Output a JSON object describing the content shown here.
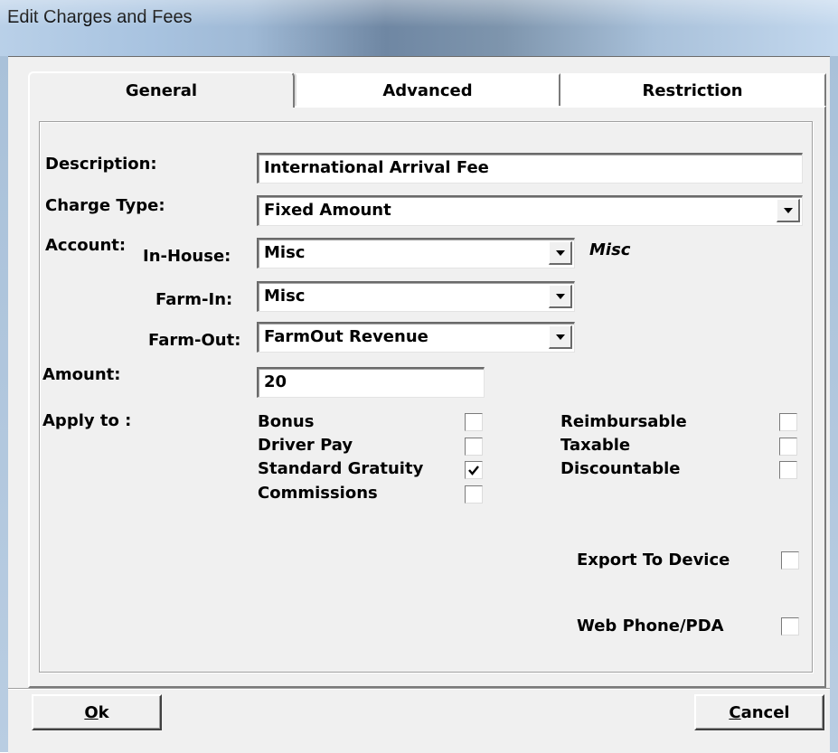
{
  "window": {
    "title": "Edit  Charges and Fees"
  },
  "tabs": [
    {
      "label": "General",
      "selected": true
    },
    {
      "label": "Advanced",
      "selected": false
    },
    {
      "label": "Restriction",
      "selected": false
    }
  ],
  "form": {
    "description": {
      "label": "Description:",
      "value": "International Arrival Fee"
    },
    "charge_type": {
      "label": "Charge Type:",
      "value": "Fixed Amount"
    },
    "account": {
      "label": "Account:",
      "in_house": {
        "label": "In-House:",
        "value": "Misc"
      },
      "farm_in": {
        "label": "Farm-In:",
        "value": "Misc"
      },
      "farm_out": {
        "label": "Farm-Out:",
        "value": "FarmOut Revenue"
      },
      "note": "Misc"
    },
    "amount": {
      "label": "Amount:",
      "value": "20"
    },
    "apply_to": {
      "label": "Apply to :",
      "left": [
        {
          "label": "Bonus",
          "checked": false
        },
        {
          "label": "Driver Pay",
          "checked": false
        },
        {
          "label": "Standard Gratuity",
          "checked": true
        },
        {
          "label": "Commissions",
          "checked": false
        }
      ],
      "right": [
        {
          "label": "Reimbursable",
          "checked": false
        },
        {
          "label": "Taxable",
          "checked": false
        },
        {
          "label": "Discountable",
          "checked": false
        }
      ]
    },
    "export_to_device": {
      "label": "Export To Device",
      "checked": false
    },
    "web_phone_pda": {
      "label": "Web Phone/PDA",
      "checked": false
    }
  },
  "buttons": {
    "ok": {
      "accel": "O",
      "rest": "k"
    },
    "cancel": {
      "accel": "C",
      "rest": "ancel"
    }
  },
  "icons": {
    "dropdown": "chevron-down-icon",
    "check": "checkmark-icon"
  }
}
